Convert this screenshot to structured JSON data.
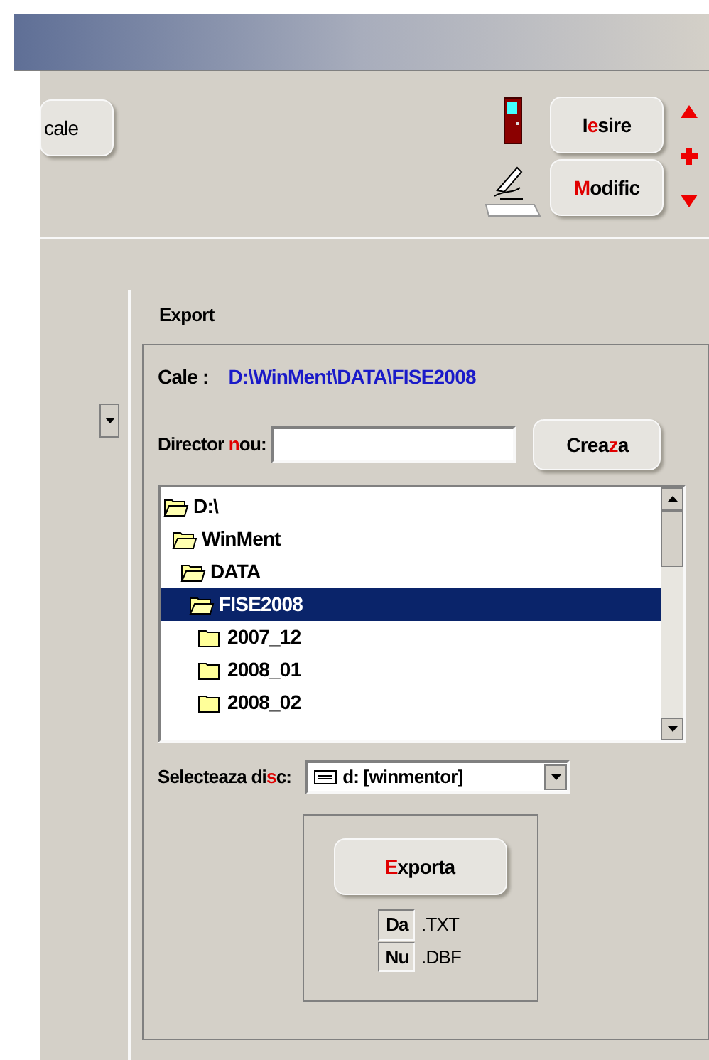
{
  "toolbar": {
    "partial_button": "cale",
    "buttons": [
      {
        "kind": "exit",
        "before": "I",
        "hotkey": "e",
        "after": "sire"
      },
      {
        "kind": "edit",
        "hotkey": "M",
        "after": "odific"
      }
    ]
  },
  "export": {
    "title": "Export",
    "path_label": "Cale :",
    "path_value": "D:\\WinMent\\DATA\\FISE2008",
    "new_dir": {
      "before": "Director ",
      "hotkey": "n",
      "after": "ou:"
    },
    "create_button": {
      "before": "Crea",
      "hotkey": "z",
      "after": "a"
    },
    "tree": [
      {
        "label": "D:\\",
        "selected": false,
        "children": [
          {
            "label": "WinMent",
            "selected": false,
            "children": [
              {
                "label": "DATA",
                "selected": false,
                "children": [
                  {
                    "label": "FISE2008",
                    "selected": true,
                    "children": [
                      {
                        "label": "2007_12",
                        "selected": false
                      },
                      {
                        "label": "2008_01",
                        "selected": false
                      },
                      {
                        "label": "2008_02",
                        "selected": false
                      }
                    ]
                  }
                ]
              }
            ]
          }
        ]
      }
    ],
    "disk": {
      "before": "Selecteaza di",
      "hotkey": "s",
      "after": "c:",
      "value": "d: [winmentor]"
    },
    "export_button": {
      "hotkey": "E",
      "after": "xporta"
    },
    "formats": [
      {
        "flag": "Da",
        "ext": ".TXT"
      },
      {
        "flag": "Nu",
        "ext": ".DBF"
      }
    ]
  }
}
